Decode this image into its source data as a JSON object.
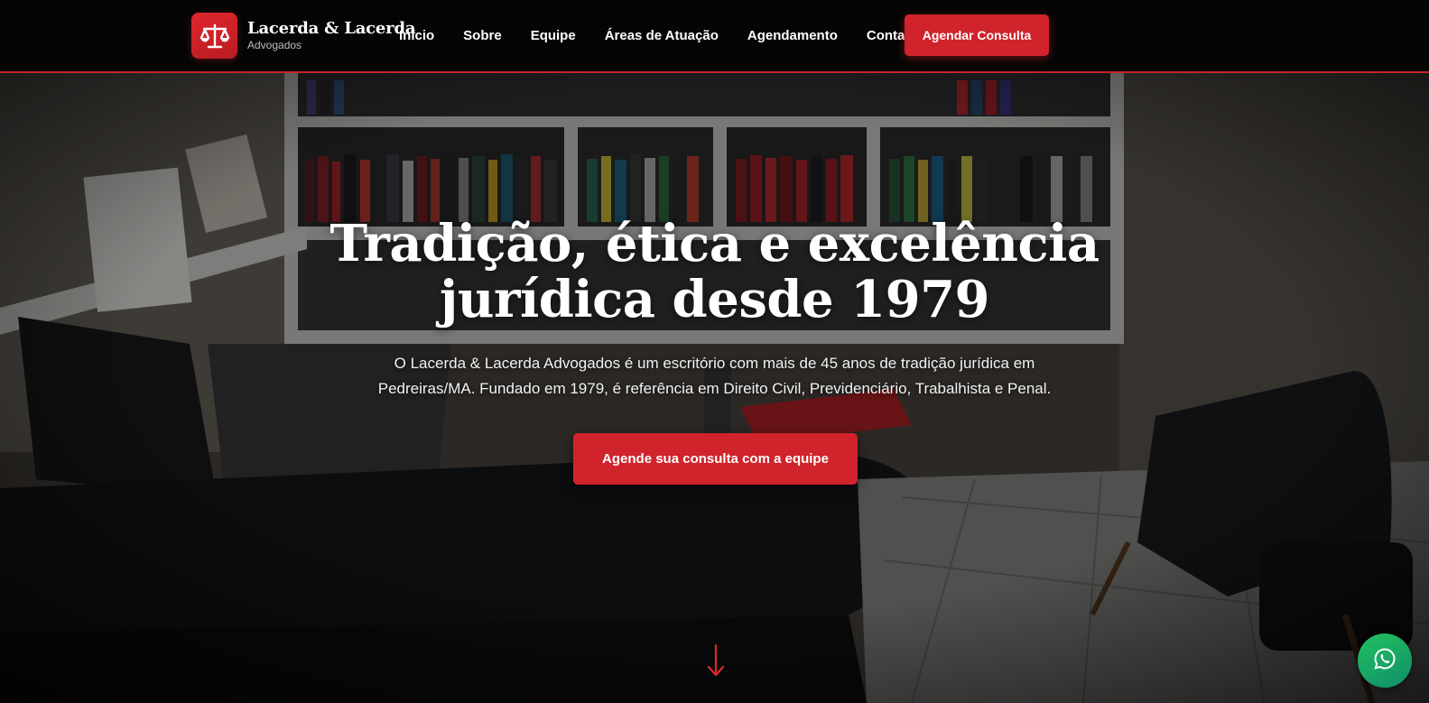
{
  "brand": {
    "name": "Lacerda & Lacerda",
    "subtitle": "Advogados",
    "logo_icon": "scales-of-justice-icon"
  },
  "nav": {
    "items": [
      {
        "label": "Início"
      },
      {
        "label": "Sobre"
      },
      {
        "label": "Equipe"
      },
      {
        "label": "Áreas de Atuação"
      },
      {
        "label": "Agendamento"
      },
      {
        "label": "Contato"
      }
    ],
    "cta_label": "Agendar Consulta"
  },
  "hero": {
    "title_line1": "Tradição, ética e excelência",
    "title_line2": "jurídica desde 1979",
    "description_line1": "O Lacerda & Lacerda Advogados é um escritório com mais de 45 anos de tradição jurídica em",
    "description_line2": "Pedreiras/MA. Fundado em 1979, é referência em Direito Civil, Previdenciário, Trabalhista e Penal.",
    "cta_label": "Agende sua consulta com a equipe",
    "scroll_icon": "arrow-down-icon"
  },
  "floating": {
    "whatsapp_icon": "whatsapp-icon"
  },
  "colors": {
    "accent": "#d0232b",
    "navbar_bg": "#050505",
    "whatsapp": "#1aa866"
  }
}
